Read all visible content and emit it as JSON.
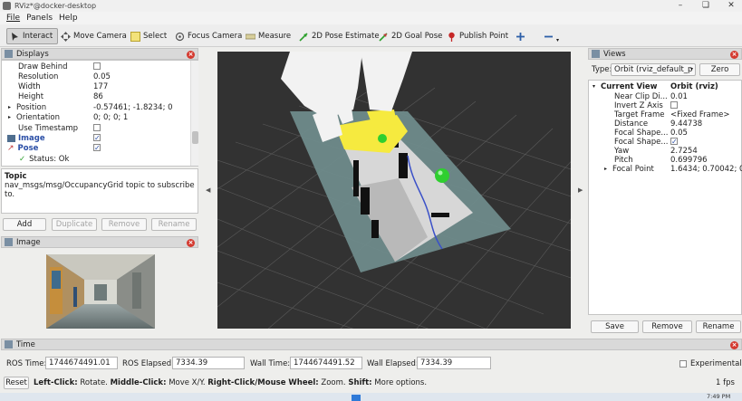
{
  "window": {
    "title": "RViz*@docker-desktop"
  },
  "menu": [
    "File",
    "Panels",
    "Help"
  ],
  "toolbar": {
    "interact": "Interact",
    "move_camera": "Move Camera",
    "select": "Select",
    "focus_camera": "Focus Camera",
    "measure": "Measure",
    "pose_estimate": "2D Pose Estimate",
    "goal_pose": "2D Goal Pose",
    "publish_point": "Publish Point"
  },
  "displays": {
    "title": "Displays",
    "rows": [
      {
        "label": "Draw Behind",
        "value": ""
      },
      {
        "label": "Resolution",
        "value": "0.05"
      },
      {
        "label": "Width",
        "value": "177"
      },
      {
        "label": "Height",
        "value": "86"
      },
      {
        "label": "Position",
        "value": "-0.57461; -1.8234; 0"
      },
      {
        "label": "Orientation",
        "value": "0; 0; 0; 1"
      },
      {
        "label": "Use Timestamp",
        "value": ""
      },
      {
        "label": "Image",
        "value": ""
      },
      {
        "label": "Pose",
        "value": ""
      },
      {
        "label": "Status: Ok",
        "value": ""
      }
    ],
    "description_title": "Topic",
    "description_text": "nav_msgs/msg/OccupancyGrid topic to subscribe to.",
    "buttons": {
      "add": "Add",
      "duplicate": "Duplicate",
      "remove": "Remove",
      "rename": "Rename"
    }
  },
  "image_panel": {
    "title": "Image"
  },
  "views": {
    "title": "Views",
    "type_label": "Type:",
    "type_value": "Orbit (rviz_default_p",
    "zero": "Zero",
    "current_view": {
      "label": "Current View",
      "value": "Orbit (rviz)"
    },
    "rows": [
      {
        "label": "Near Clip Di...",
        "value": "0.01"
      },
      {
        "label": "Invert Z Axis",
        "value": ""
      },
      {
        "label": "Target Frame",
        "value": "<Fixed Frame>"
      },
      {
        "label": "Distance",
        "value": "9.44738"
      },
      {
        "label": "Focal Shape...",
        "value": "0.05"
      },
      {
        "label": "Focal Shape...",
        "value": ""
      },
      {
        "label": "Yaw",
        "value": "2.7254"
      },
      {
        "label": "Pitch",
        "value": "0.699796"
      },
      {
        "label": "Focal Point",
        "value": "1.6434; 0.70042; 0..."
      }
    ],
    "buttons": {
      "save": "Save",
      "remove": "Remove",
      "rename": "Rename"
    }
  },
  "time": {
    "title": "Time",
    "ros_time_label": "ROS Time:",
    "ros_time": "1744674491.01",
    "ros_elapsed_label": "ROS Elapsed:",
    "ros_elapsed": "7334.39",
    "wall_time_label": "Wall Time:",
    "wall_time": "1744674491.52",
    "wall_elapsed_label": "Wall Elapsed:",
    "wall_elapsed": "7334.39",
    "experimental": "Experimental"
  },
  "status": {
    "reset": "Reset",
    "left_click_key": "Left-Click:",
    "left_click_val": "Rotate.",
    "middle_click_key": "Middle-Click:",
    "middle_click_val": "Move X/Y.",
    "right_click_key": "Right-Click/Mouse Wheel:",
    "right_click_val": "Zoom.",
    "shift_key": "Shift:",
    "shift_val": "More options.",
    "fps": "1 fps"
  },
  "taskbar": {
    "clock": "7:49 PM"
  }
}
